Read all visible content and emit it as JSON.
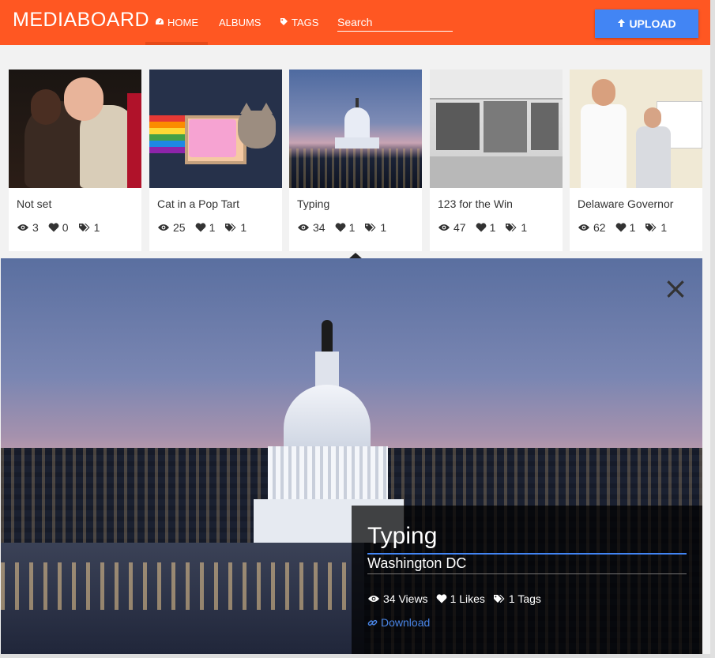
{
  "nav": {
    "brand": "MEDIABOARD",
    "home": "HOME",
    "albums": "ALBUMS",
    "tags": "TAGS",
    "search_placeholder": "Search",
    "upload": "UPLOAD"
  },
  "cards": [
    {
      "title": "Not set",
      "views": "3",
      "likes": "0",
      "tags": "1"
    },
    {
      "title": "Cat in a Pop Tart",
      "views": "25",
      "likes": "1",
      "tags": "1"
    },
    {
      "title": "Typing",
      "views": "34",
      "likes": "1",
      "tags": "1"
    },
    {
      "title": "123 for the Win",
      "views": "47",
      "likes": "1",
      "tags": "1"
    },
    {
      "title": "Delaware Governor",
      "views": "62",
      "likes": "1",
      "tags": "1"
    }
  ],
  "preview": {
    "close": "×",
    "title": "Typing",
    "subtitle": "Washington DC",
    "views": "34 Views",
    "likes": "1 Likes",
    "tags": "1 Tags",
    "download": "Download"
  },
  "colors": {
    "navbar": "#ff5722",
    "upload_button": "#4285f4",
    "link": "#4a86e8"
  }
}
